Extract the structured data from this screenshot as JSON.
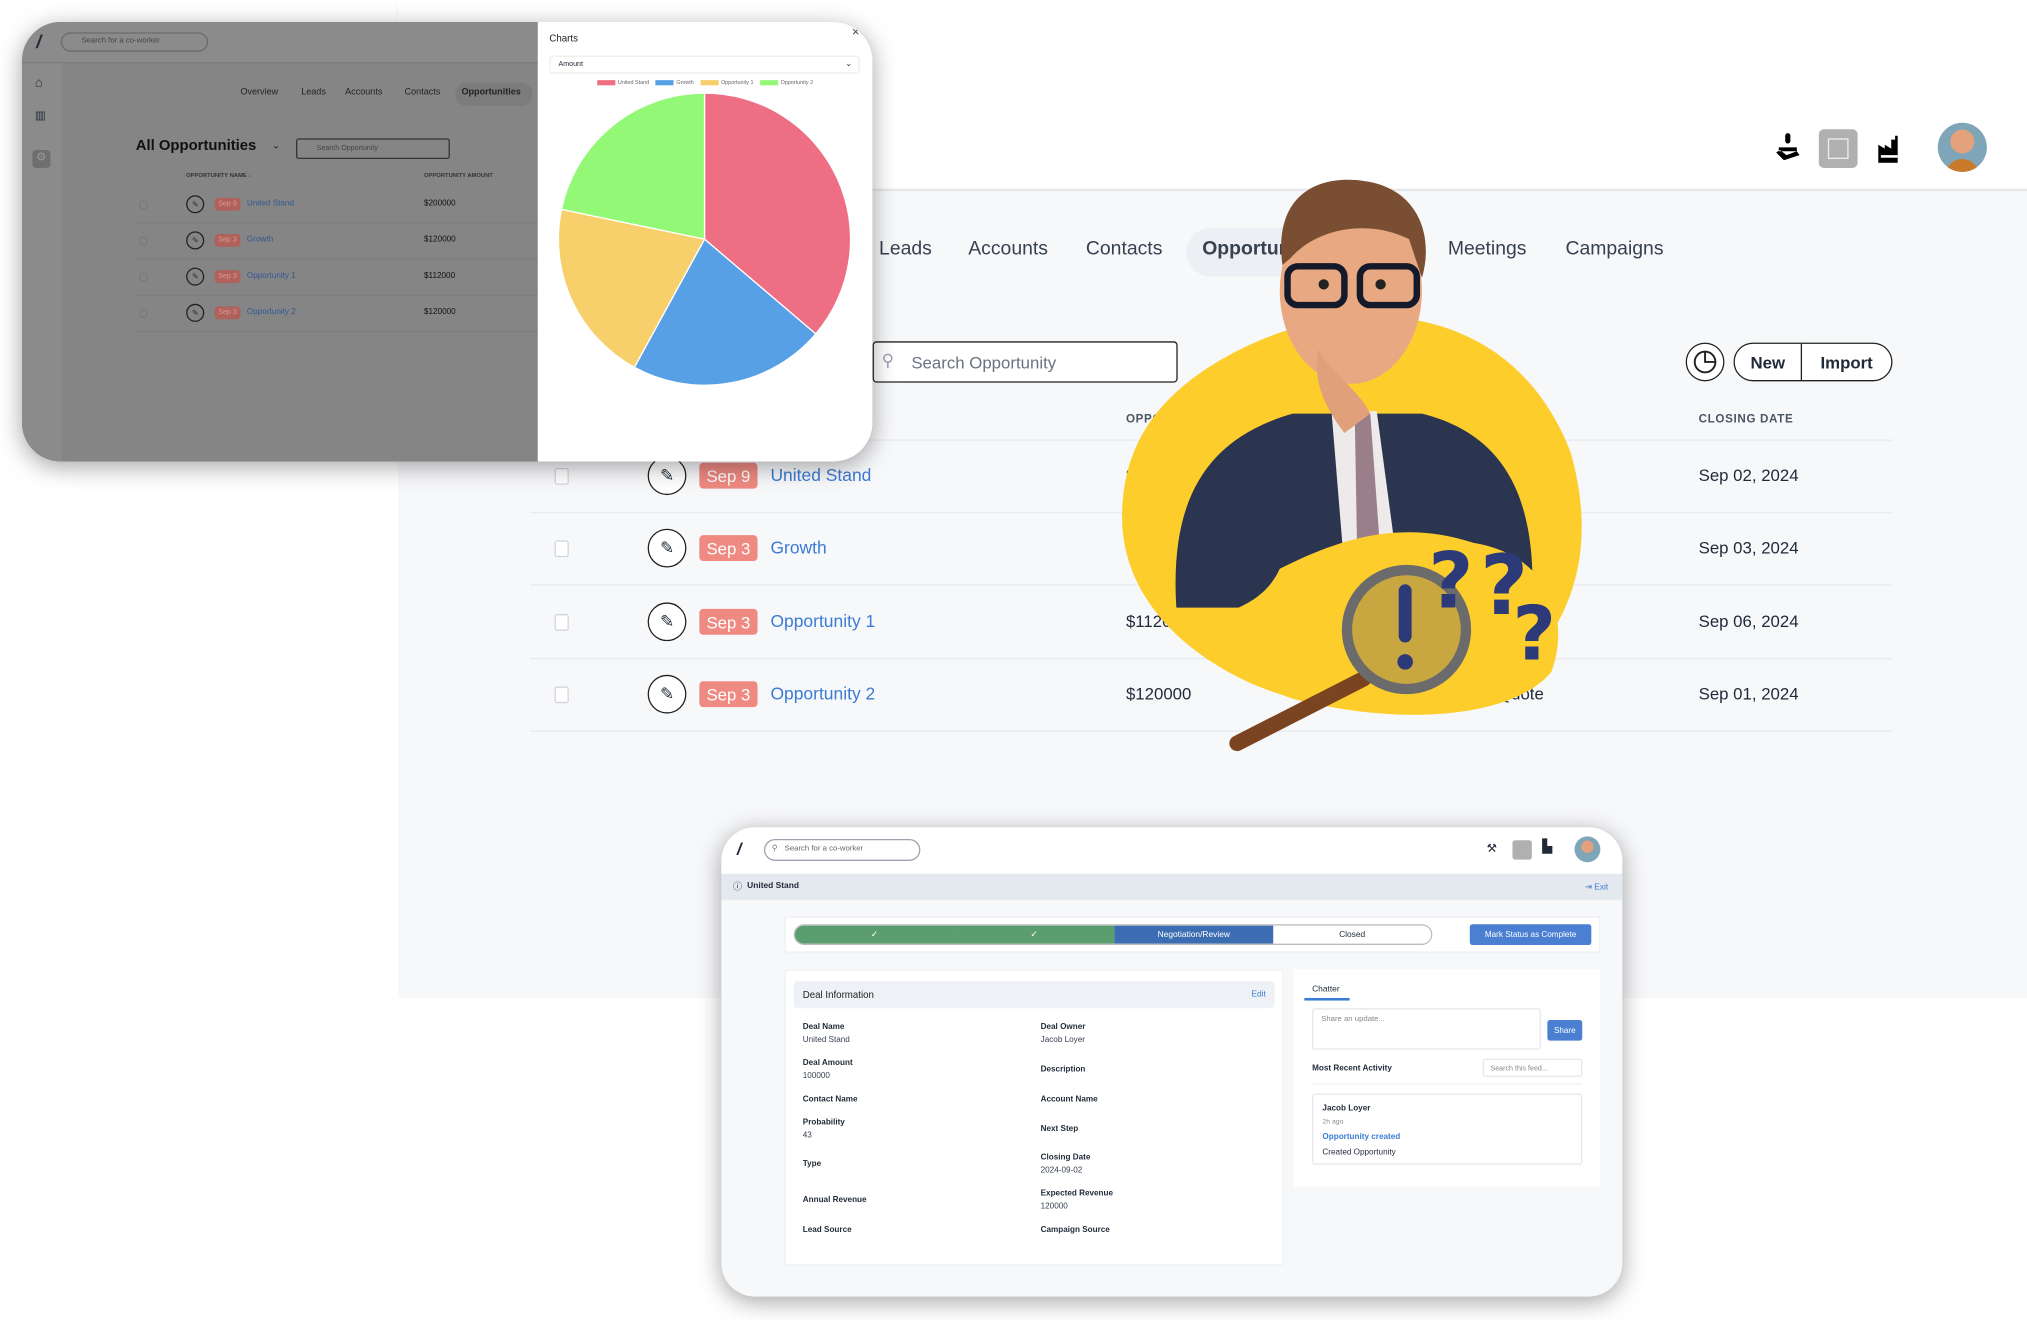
{
  "header": {
    "icons": [
      "hand-stamp-icon",
      "invoice-icon",
      "factory-icon"
    ],
    "avatar": "user-avatar"
  },
  "nav": {
    "tabs": [
      {
        "label": "Leads"
      },
      {
        "label": "Accounts"
      },
      {
        "label": "Contacts"
      },
      {
        "label": "Opportunities",
        "active": true
      },
      {
        "label": "Meetings"
      },
      {
        "label": "Campaigns"
      }
    ]
  },
  "toolbar": {
    "search_placeholder": "Search Opportunity",
    "new_label": "New",
    "import_label": "Import",
    "chart_icon": "pie-chart-icon"
  },
  "table": {
    "columns": [
      "OPPORTUNITY NAME",
      "CLOSING DATE"
    ],
    "column_short": "OPPORT",
    "rows": [
      {
        "badge": "Sep 9",
        "name": "United Stand",
        "amount": "$200000",
        "stage": "",
        "closing": "Sep 02, 2024"
      },
      {
        "badge": "Sep 3",
        "name": "Growth",
        "amount": "$120000",
        "stage": "",
        "closing": "Sep 03, 2024"
      },
      {
        "badge": "Sep 3",
        "name": "Opportunity 1",
        "amount": "$112000",
        "stage": "",
        "closing": "Sep 06, 2024"
      },
      {
        "badge": "Sep 3",
        "name": "Opportunity 2",
        "amount": "$120000",
        "stage": "e Quote",
        "closing": "Sep 01, 2024"
      }
    ]
  },
  "overlay_app": {
    "search_placeholder": "Search for a co-worker",
    "tabs": [
      "Overview",
      "Leads",
      "Accounts",
      "Contacts",
      "Opportunities"
    ],
    "list_title": "All Opportunities",
    "list_search_placeholder": "Search Opportunity",
    "col_name": "OPPORTUNITY NAME ↓",
    "col_amount": "OPPORTUNITY AMOUNT",
    "rows": [
      {
        "badge": "Sep 9",
        "name": "United Stand",
        "amount": "$200000"
      },
      {
        "badge": "Sep 3",
        "name": "Growth",
        "amount": "$120000"
      },
      {
        "badge": "Sep 3",
        "name": "Opportunity 1",
        "amount": "$112000"
      },
      {
        "badge": "Sep 3",
        "name": "Opportunity 2",
        "amount": "$120000"
      }
    ]
  },
  "charts_panel": {
    "title": "Charts",
    "select_value": "Amount",
    "close": "×"
  },
  "chart_data": {
    "type": "pie",
    "categories": [
      "United Stand",
      "Growth",
      "Opportunity 1",
      "Opportunity 2"
    ],
    "values": [
      200000,
      120000,
      112000,
      120000
    ],
    "colors": [
      "#ee6e84",
      "#57a0e5",
      "#f7cf6b",
      "#93f876"
    ],
    "legend": "top"
  },
  "detail": {
    "search_placeholder": "Search for a co-worker",
    "record_title": "United Stand",
    "exit_label": "Exit",
    "path": [
      {
        "label": "✓",
        "state": "done"
      },
      {
        "label": "✓",
        "state": "done"
      },
      {
        "label": "Negotiation/Review",
        "state": "current"
      },
      {
        "label": "Closed",
        "state": "todo"
      }
    ],
    "mark_button": "Mark Status as Complete",
    "deal_title": "Deal Information",
    "edit_label": "Edit",
    "fields": {
      "deal_name": {
        "label": "Deal Name",
        "value": "United Stand"
      },
      "deal_owner": {
        "label": "Deal Owner",
        "value": "Jacob Loyer"
      },
      "deal_amount": {
        "label": "Deal Amount",
        "value": "100000"
      },
      "description": {
        "label": "Description"
      },
      "contact_name": {
        "label": "Contact Name"
      },
      "account_name": {
        "label": "Account Name"
      },
      "probability": {
        "label": "Probability",
        "value": "43"
      },
      "next_step": {
        "label": "Next Step"
      },
      "type": {
        "label": "Type"
      },
      "closing_date": {
        "label": "Closing Date",
        "value": "2024-09-02"
      },
      "annual_revenue": {
        "label": "Annual Revenue"
      },
      "expected_revenue": {
        "label": "Expected Revenue",
        "value": "120000"
      },
      "lead_source": {
        "label": "Lead Source"
      },
      "campaign_source": {
        "label": "Campaign Source"
      }
    },
    "chatter": {
      "tab": "Chatter",
      "placeholder": "Share an update...",
      "share": "Share",
      "recent": "Most Recent Activity",
      "feed_placeholder": "Search this feed...",
      "activity": {
        "user": "Jacob Loyer",
        "time": "2h ago",
        "action": "Opportunity created",
        "detail": "Created Opportunity"
      }
    }
  },
  "colors": {
    "accent": "#3b7bd4",
    "badge": "#ee8a82",
    "path_done": "#5a9e6f",
    "path_current": "#3c6db3",
    "button": "#4a7fd1",
    "blob": "#fdcd2c"
  }
}
